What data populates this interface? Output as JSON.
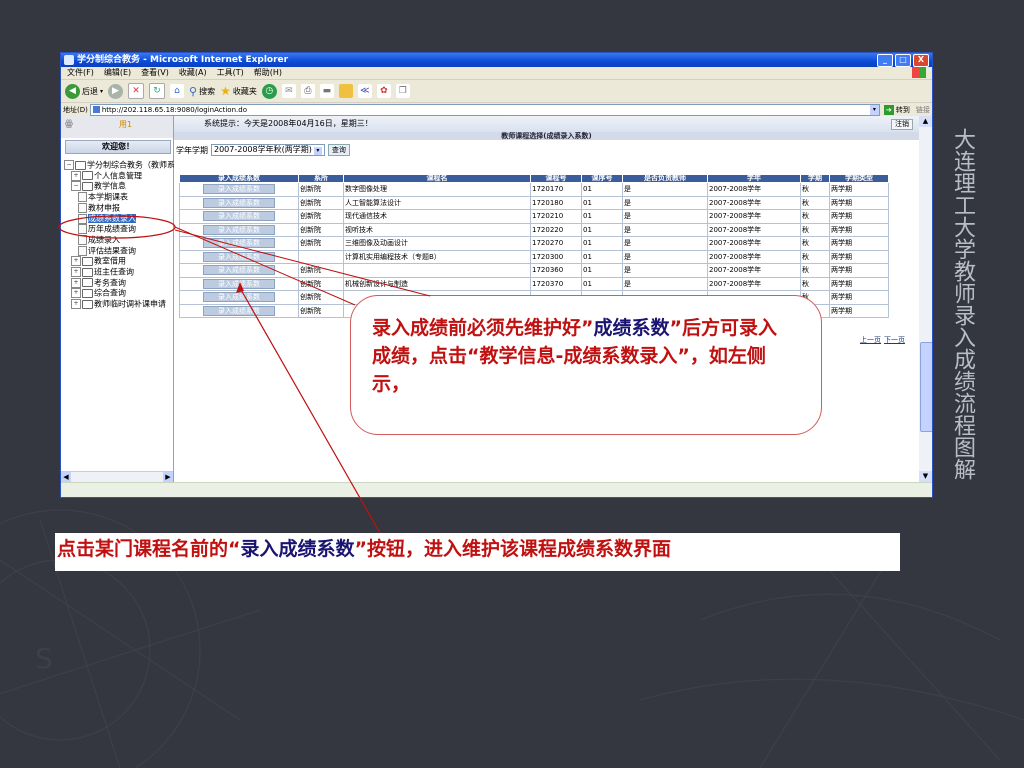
{
  "slide": {
    "title": "大连理工大学教师录入成绩流程图解",
    "callout": {
      "part1": "录入成绩前必须先维护好”",
      "part2": "成绩系数",
      "part3": "”后方可录入成绩，点击“教学信息-成绩系数录入”，如左侧示，"
    },
    "caption": {
      "part1": "点击某门课程名前的“",
      "part2": "录入成绩系数",
      "part3": "”按钮，进入维护该课程成绩系数界面"
    }
  },
  "browser": {
    "window_title": "学分制综合教务 - Microsoft Internet Explorer",
    "window_buttons": [
      "_",
      "□",
      "X"
    ],
    "menu": [
      "文件(F)",
      "编辑(E)",
      "查看(V)",
      "收藏(A)",
      "工具(T)",
      "帮助(H)"
    ],
    "toolbar": {
      "back_label": "后退",
      "search_label": "搜索",
      "favorites_label": "收藏夹"
    },
    "address": {
      "label": "地址(D)",
      "url": "http://202.118.65.18:9080/loginAction.do",
      "go_label": "转到",
      "links_label": "链接"
    }
  },
  "app": {
    "system_notice": "系统提示：今天是2008年04月16日，星期三！",
    "logout_label": "注销",
    "welcome": "欢迎您！",
    "sidebar_top_label": "用1",
    "tree": [
      {
        "label": "学分制综合教务（教师系统",
        "level": 0,
        "node": "−"
      },
      {
        "label": "个人信息管理",
        "level": 1,
        "node": "+"
      },
      {
        "label": "教学信息",
        "level": 1,
        "node": "−"
      },
      {
        "label": "本学期课表",
        "level": 2,
        "node": ""
      },
      {
        "label": "教材申报",
        "level": 2,
        "node": ""
      },
      {
        "label": "成绩系数录入",
        "level": 2,
        "node": "",
        "selected": true
      },
      {
        "label": "历年成绩查询",
        "level": 2,
        "node": ""
      },
      {
        "label": "成绩录入",
        "level": 2,
        "node": ""
      },
      {
        "label": "评估结果查询",
        "level": 2,
        "node": ""
      },
      {
        "label": "教室借用",
        "level": 1,
        "node": "+"
      },
      {
        "label": "班主任查询",
        "level": 1,
        "node": "+"
      },
      {
        "label": "考务查询",
        "level": 1,
        "node": "+"
      },
      {
        "label": "综合查询",
        "level": 1,
        "node": "+"
      },
      {
        "label": "教师临时调补课申请",
        "level": 1,
        "node": "+"
      }
    ],
    "content_title": "教师课程选择(成绩录入系数)",
    "term_label": "学年学期",
    "term_value": "2007-2008学年秋(两学期)",
    "query_label": "查询",
    "table": {
      "headers": [
        "录入成绩系数",
        "系所",
        "课程名",
        "课程号",
        "课序号",
        "是否负责教师",
        "学年",
        "学期",
        "学期类型"
      ],
      "button_label": "录入成绩系数",
      "rows": [
        [
          "创新院",
          "数字图像处理",
          "1720170",
          "01",
          "是",
          "2007-2008学年",
          "秋",
          "两学期"
        ],
        [
          "创新院",
          "人工智能算法设计",
          "1720180",
          "01",
          "是",
          "2007-2008学年",
          "秋",
          "两学期"
        ],
        [
          "创新院",
          "现代通信技术",
          "1720210",
          "01",
          "是",
          "2007-2008学年",
          "秋",
          "两学期"
        ],
        [
          "创新院",
          "视听技术",
          "1720220",
          "01",
          "是",
          "2007-2008学年",
          "秋",
          "两学期"
        ],
        [
          "创新院",
          "三维图像及动画设计",
          "1720270",
          "01",
          "是",
          "2007-2008学年",
          "秋",
          "两学期"
        ],
        [
          "",
          "计算机实用编程技术（专题B）",
          "1720300",
          "01",
          "是",
          "2007-2008学年",
          "秋",
          "两学期"
        ],
        [
          "创新院",
          "",
          "1720360",
          "01",
          "是",
          "2007-2008学年",
          "秋",
          "两学期"
        ],
        [
          "创新院",
          "机械创新设计与制造",
          "1720370",
          "01",
          "是",
          "2007-2008学年",
          "秋",
          "两学期"
        ],
        [
          "创新院",
          "",
          "",
          "",
          "",
          "",
          "秋",
          "两学期"
        ],
        [
          "创新院",
          "",
          "",
          "",
          "",
          "",
          "",
          "两学期"
        ]
      ]
    },
    "pager": {
      "prev": "上一页",
      "next": "下一页"
    }
  },
  "colors": {
    "slide_bg": "#34373f",
    "accent_red": "#c01010",
    "accent_navy": "#1a1470",
    "table_header": "#3b5d9b",
    "title_text": "#b9bdc6"
  }
}
